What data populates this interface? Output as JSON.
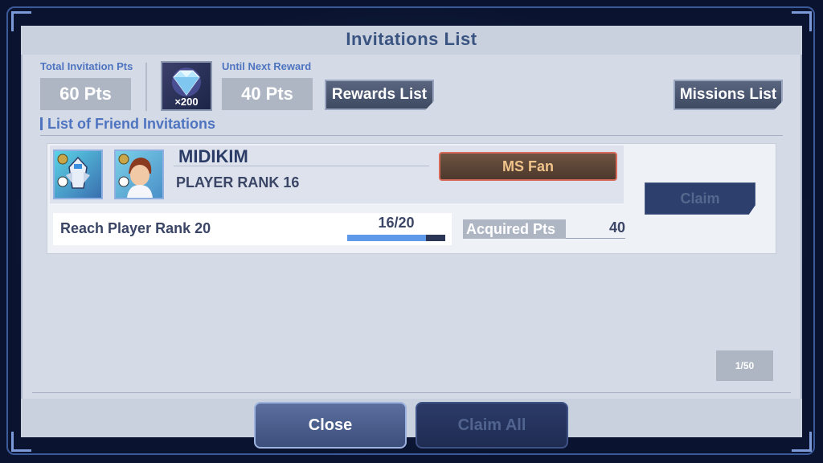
{
  "title": "Invitations List",
  "summary": {
    "total_label": "Total Invitation Pts",
    "total_value": "60 Pts",
    "reward_count": "×200",
    "next_label": "Until Next Reward",
    "next_value": "40 Pts",
    "rewards_button": "Rewards List",
    "missions_button": "Missions List"
  },
  "section_title": "List of Friend Invitations",
  "invitation": {
    "player_name": "MIDIKIM",
    "player_rank": "PLAYER RANK 16",
    "badge": "MS Fan",
    "mission": "Reach Player Rank 20",
    "progress_text": "16/20",
    "progress_fraction": 0.8,
    "acquired_label": "Acquired Pts",
    "acquired_value": "40",
    "claim_button": "Claim"
  },
  "pagination": "1/50",
  "footer": {
    "close_button": "Close",
    "claim_all_button": "Claim All"
  },
  "colors": {
    "accent_blue": "#4e74c0",
    "panel": "#d5dbe6",
    "badge_border": "#d86a5a"
  }
}
